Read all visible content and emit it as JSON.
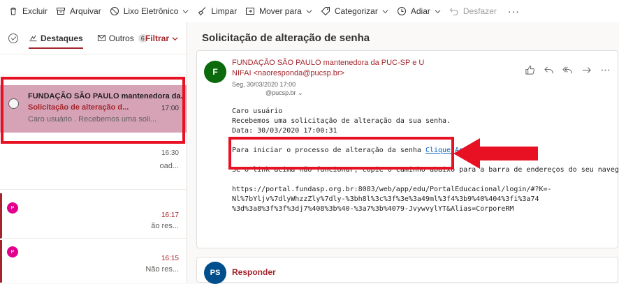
{
  "toolbar": {
    "excluir": "Excluir",
    "arquivar": "Arquivar",
    "lixo": "Lixo Eletrônico",
    "limpar": "Limpar",
    "mover": "Mover para",
    "categorizar": "Categorizar",
    "adiar": "Adiar",
    "desfazer": "Desfazer",
    "more": "···"
  },
  "list": {
    "tab_destaques": "Destaques",
    "tab_outros": "Outros",
    "outros_count": "6",
    "filter": "Filtrar",
    "messages": [
      {
        "sender": "FUNDAÇÃO SÃO PAULO mantenedora da..",
        "subject": "Solicitação de alteração d...",
        "time": "17:00",
        "preview": "Caro usuário              . Recebemos uma soli..."
      },
      {
        "time": "16:30",
        "preview": "oad..."
      },
      {
        "avatar": "P",
        "time": "16:17",
        "preview": "ão res..."
      },
      {
        "avatar": "P",
        "time": "16:15",
        "preview": "Não res..."
      }
    ]
  },
  "reading": {
    "subject": "Solicitação de alteração de senha",
    "avatar": "F",
    "from_name": "FUNDAÇÃO SÃO PAULO mantenedora da PUC-SP e U NIFAI",
    "from_email": "<naoresponda@pucsp.br>",
    "date": "Seg, 30/03/2020 17:00",
    "to": "@pucsp.br",
    "body": {
      "greeting": "Caro usuário",
      "line1": "Recebemos uma solicitação de alteração da sua senha.",
      "line2": "Data: 30/03/2020 17:00:31",
      "link_prefix": "Para iniciar o processo de alteração da senha ",
      "link_text": "Clique Aqui",
      "line3": "Se o link acima não funcionar, copie o caminho abaixo para a barra de endereços do seu navegador.",
      "url1": "https://portal.fundasp.org.br:8083/web/app/edu/PortalEducacional/login/#?K=-",
      "url2": "Nl%7bYljv%7dlyWhzzZly%7dly-%3bh8l%3c%3f%3e%3a49ml%3f4%3b9%40%404%3fi%3a74",
      "url3": "%3d%3a8%3f%3f%3dj7%408%3b%40-%3a7%3b%4079-JvywvylYT&Alias=CorporeRM"
    },
    "reply_avatar": "PS",
    "reply_label": "Responder"
  },
  "colors": {
    "accent": "#a4262c",
    "highlight": "#e81123",
    "selected_row": "#d6a3b6",
    "avatar_f": "#0b6a0b",
    "avatar_p": "#e3008c",
    "avatar_ps": "#004e8c"
  }
}
